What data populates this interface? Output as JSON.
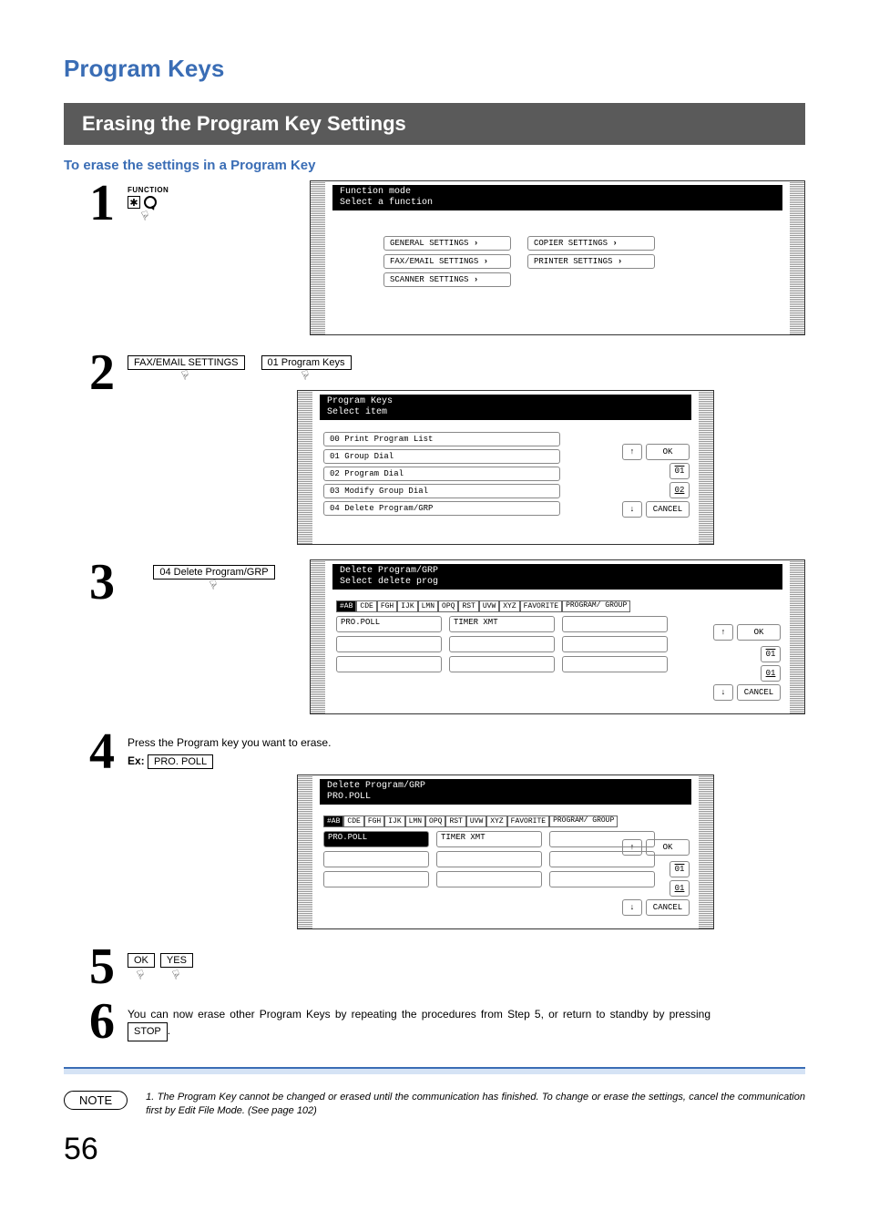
{
  "heading1": "Program Keys",
  "section_title": "Erasing the Program Key Settings",
  "sub_heading": "To erase the settings in a Program Key",
  "step1": {
    "function_label": "FUNCTION",
    "lcd_title_line1": "Function mode",
    "lcd_title_line2": "Select a function",
    "btn_general": "GENERAL SETTINGS",
    "btn_copier": "COPIER SETTINGS",
    "btn_fax": "FAX/EMAIL SETTINGS",
    "btn_printer": "PRINTER SETTINGS",
    "btn_scanner": "SCANNER SETTINGS"
  },
  "step2": {
    "mid_btn1": "FAX/EMAIL SETTINGS",
    "mid_btn2": "01 Program Keys",
    "lcd_title_line1": "Program Keys",
    "lcd_title_line2": "Select item",
    "list": {
      "i0": "00  Print Program List",
      "i1": "01  Group Dial",
      "i2": "02  Program Dial",
      "i3": "03  Modify Group Dial",
      "i4": "04  Delete Program/GRP"
    },
    "ok": "OK",
    "cancel": "CANCEL",
    "pg1": "01",
    "pg2": "02"
  },
  "step3": {
    "mid_btn": "04 Delete Program/GRP",
    "lcd_title_line1": "Delete Program/GRP",
    "lcd_title_line2": "Select delete prog",
    "tabs": {
      "t0": "#AB",
      "t1": "CDE",
      "t2": "FGH",
      "t3": "IJK",
      "t4": "LMN",
      "t5": "OPQ",
      "t6": "RST",
      "t7": "UVW",
      "t8": "XYZ",
      "t9": "FAVORITE",
      "t10": "PROGRAM/\nGROUP"
    },
    "slot_pro": "PRO.POLL",
    "slot_timer": "TIMER XMT",
    "ok": "OK",
    "cancel": "CANCEL",
    "pg1": "01",
    "pg2": "01"
  },
  "step4": {
    "text": "Press the Program key you want to erase.",
    "ex_label": "Ex:",
    "ex_btn": "PRO. POLL",
    "lcd_title_line1": "Delete Program/GRP",
    "lcd_title_line2": "PRO.POLL",
    "slot_pro": "PRO.POLL",
    "slot_timer": "TIMER XMT",
    "ok": "OK",
    "cancel": "CANCEL",
    "pg1": "01",
    "pg2": "01"
  },
  "step5": {
    "btn_ok": "OK",
    "btn_yes": "YES"
  },
  "step6": {
    "text_a": "You can now erase other Program Keys by repeating the procedures from Step 5, or return to standby by pressing ",
    "stop": "STOP",
    "text_b": "."
  },
  "note": {
    "label": "NOTE",
    "text": "1. The Program Key cannot be changed or erased until the communication has finished. To change or erase the settings, cancel the communication first by Edit File Mode. (See page 102)"
  },
  "page_number": "56"
}
